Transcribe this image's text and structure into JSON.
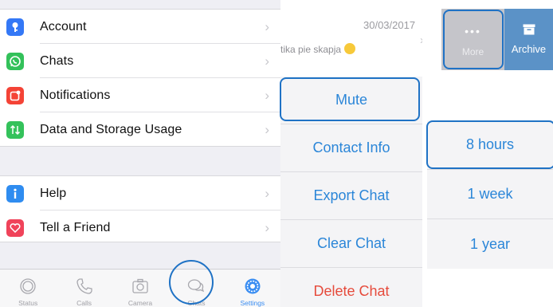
{
  "settings": {
    "items": [
      {
        "label": "Account",
        "icon": "key-icon"
      },
      {
        "label": "Chats",
        "icon": "whatsapp-icon"
      },
      {
        "label": "Notifications",
        "icon": "notification-icon"
      },
      {
        "label": "Data and Storage Usage",
        "icon": "arrows-updown-icon"
      }
    ],
    "items2": [
      {
        "label": "Help",
        "icon": "info-icon"
      },
      {
        "label": "Tell a Friend",
        "icon": "heart-icon"
      }
    ]
  },
  "tabbar": {
    "tabs": [
      {
        "label": "Status"
      },
      {
        "label": "Calls"
      },
      {
        "label": "Camera"
      },
      {
        "label": "Chats"
      },
      {
        "label": "Settings"
      }
    ],
    "active": "Settings"
  },
  "chat": {
    "date": "30/03/2017",
    "snippet": "tika pie skapja",
    "actions": [
      "Mute",
      "Contact Info",
      "Export Chat",
      "Clear Chat",
      "Delete Chat"
    ]
  },
  "swipe": {
    "more_label": "More",
    "archive_label": "Archive"
  },
  "mute_durations": [
    "8 hours",
    "1 week",
    "1 year"
  ],
  "colors": {
    "accent": "#2b86d8",
    "highlight": "#1f72c5",
    "destructive": "#e64b3c",
    "tab_active": "#3b8ef2",
    "archive": "#5b92c7"
  }
}
